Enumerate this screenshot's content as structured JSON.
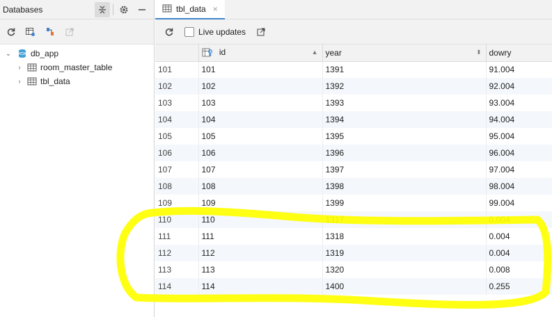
{
  "left_panel": {
    "title": "Databases",
    "tree": {
      "root": {
        "label": "db_app"
      },
      "children": [
        {
          "label": "room_master_table"
        },
        {
          "label": "tbl_data"
        }
      ]
    }
  },
  "editor": {
    "tab": {
      "label": "tbl_data"
    },
    "toolbar": {
      "live_updates_label": "Live updates"
    },
    "columns": [
      "id",
      "year",
      "dowry"
    ],
    "rows": [
      {
        "rownum": "101",
        "id": "101",
        "year": "1391",
        "dowry": "91.004"
      },
      {
        "rownum": "102",
        "id": "102",
        "year": "1392",
        "dowry": "92.004"
      },
      {
        "rownum": "103",
        "id": "103",
        "year": "1393",
        "dowry": "93.004"
      },
      {
        "rownum": "104",
        "id": "104",
        "year": "1394",
        "dowry": "94.004"
      },
      {
        "rownum": "105",
        "id": "105",
        "year": "1395",
        "dowry": "95.004"
      },
      {
        "rownum": "106",
        "id": "106",
        "year": "1396",
        "dowry": "96.004"
      },
      {
        "rownum": "107",
        "id": "107",
        "year": "1397",
        "dowry": "97.004"
      },
      {
        "rownum": "108",
        "id": "108",
        "year": "1398",
        "dowry": "98.004"
      },
      {
        "rownum": "109",
        "id": "109",
        "year": "1399",
        "dowry": "99.004"
      },
      {
        "rownum": "110",
        "id": "110",
        "year": "1317",
        "dowry": "0.004"
      },
      {
        "rownum": "111",
        "id": "111",
        "year": "1318",
        "dowry": "0.004"
      },
      {
        "rownum": "112",
        "id": "112",
        "year": "1319",
        "dowry": "0.004"
      },
      {
        "rownum": "113",
        "id": "113",
        "year": "1320",
        "dowry": "0.008"
      },
      {
        "rownum": "114",
        "id": "114",
        "year": "1400",
        "dowry": "0.255"
      }
    ]
  },
  "colors": {
    "highlighter": "#ffff00",
    "accent": "#4083c9",
    "row_alt": "#f4f7fb"
  }
}
